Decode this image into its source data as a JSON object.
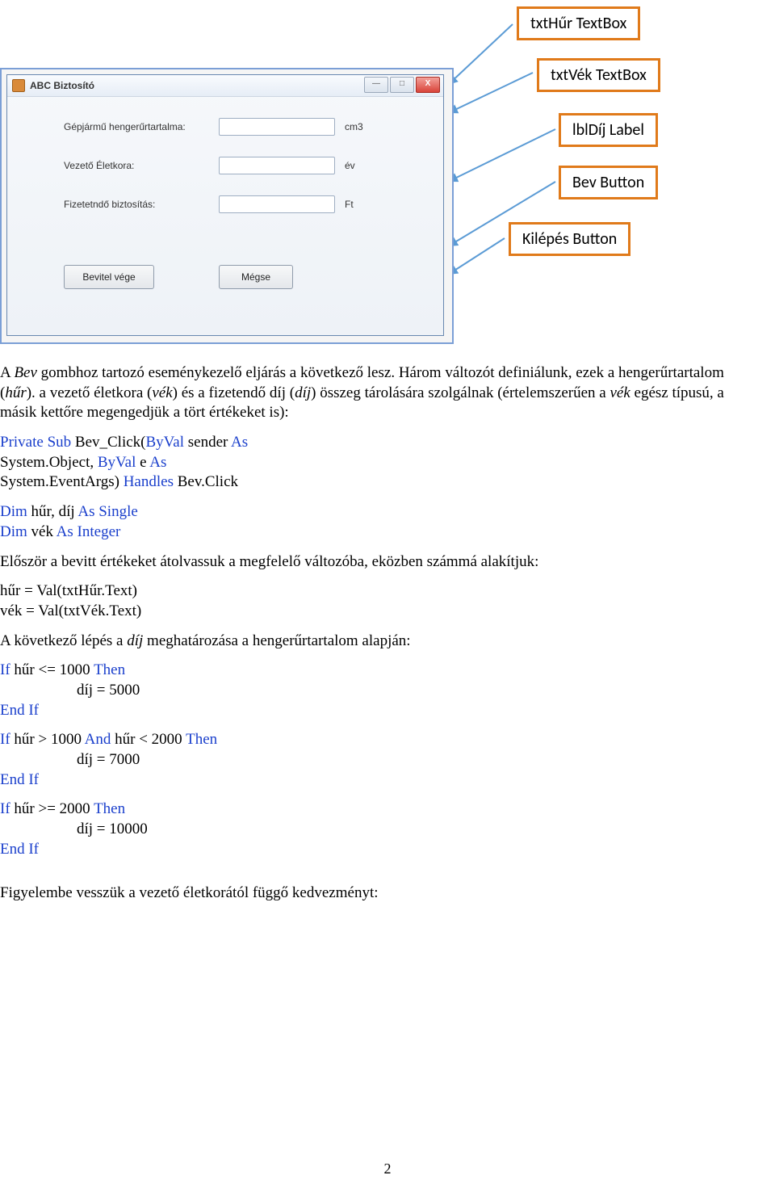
{
  "form": {
    "title": "ABC Biztosító",
    "labels": {
      "hur": "Gépjármű hengerűrtartalma:",
      "vek": "Vezető Életkora:",
      "dij": "Fizetetndő biztosítás:"
    },
    "units": {
      "hur": "cm3",
      "vek": "év",
      "dij": "Ft"
    },
    "buttons": {
      "bev": "Bevitel vége",
      "megse": "Mégse"
    },
    "win": {
      "min": "—",
      "max": "□",
      "close": "X"
    }
  },
  "callouts": {
    "txtHur": "txtHűr TextBox",
    "txtVek": "txtVék TextBox",
    "lblDij": "lblDíj Label",
    "bev": "Bev Button",
    "kilepes": "Kilépés Button"
  },
  "text": {
    "p1a": "A ",
    "p1b": "Bev",
    "p1c": " gombhoz tartozó eseménykezelő eljárás a következő lesz. Három változót definiálunk, ezek a hengerűrtartalom (",
    "p1d": "hűr",
    "p1e": "). a vezető életkora (",
    "p1f": "vék",
    "p1g": ") és a fizetendő díj (",
    "p1h": "díj",
    "p1i": ") összeg tárolására szolgálnak (értelemszerűen a ",
    "p1j": "vék",
    "p1k": " egész típusú, a másik kettőre megengedjük a tört értékeket is):",
    "c1a": "Private Sub",
    "c1b": " Bev_Click(",
    "c1c": "ByVal",
    "c1d": " sender ",
    "c1e": "As",
    "c1f": " System.Object, ",
    "c1g": "ByVal",
    "c1h": " e ",
    "c1i": "As",
    "c1j": " System.EventArgs) ",
    "c1k": "Handles",
    "c1l": " Bev.Click",
    "c2a": "Dim",
    "c2b": " hűr, díj ",
    "c2c": "As Single",
    "c3a": "Dim",
    "c3b": " vék ",
    "c3c": "As Integer",
    "p2": "Először a bevitt értékeket átolvassuk a megfelelő változóba, eközben számmá alakítjuk:",
    "c4": "hűr = Val(txtHűr.Text)",
    "c5": "vék = Val(txtVék.Text)",
    "p3a": "A következő lépés a ",
    "p3b": "díj",
    "p3c": " meghatározása a hengerűrtartalom alapján:",
    "if1a": "If",
    "if1b": " hűr <= 1000 ",
    "if1c": "Then",
    "if1d": "díj = 5000",
    "endif": "End If",
    "if2a": "If",
    "if2b": " hűr > 1000 ",
    "if2c": "And",
    "if2d": " hűr < 2000 ",
    "if2e": "Then",
    "if2f": "díj = 7000",
    "if3a": "If",
    "if3b": " hűr >= 2000 ",
    "if3c": "Then",
    "if3d": "díj = 10000",
    "p4": "Figyelembe vesszük a vezető életkorától függő kedvezményt:",
    "pagenum": "2"
  }
}
